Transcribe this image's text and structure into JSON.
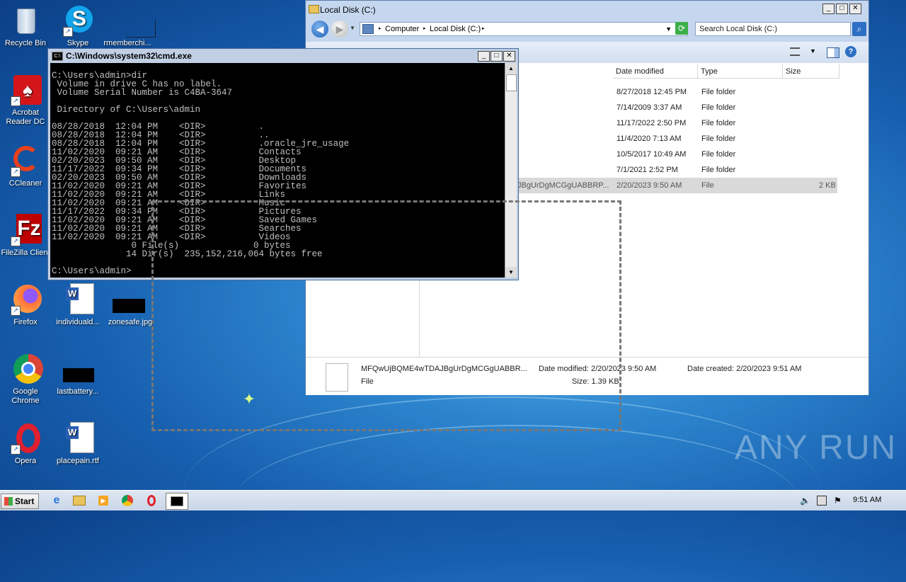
{
  "desktop_icons": [
    {
      "label": "Recycle Bin"
    },
    {
      "label": "Skype"
    },
    {
      "label": "rmemberchi..."
    },
    {
      "label": "Acrobat Reader DC"
    },
    {
      "label": "CCleaner"
    },
    {
      "label": "FileZilla Client"
    },
    {
      "label": "Firefox"
    },
    {
      "label": "individuald..."
    },
    {
      "label": "zonesafe.jpg"
    },
    {
      "label": "Google Chrome"
    },
    {
      "label": "lastbattery..."
    },
    {
      "label": "Opera"
    },
    {
      "label": "placepain.rtf"
    }
  ],
  "explorer": {
    "title": "Local Disk (C:)",
    "address": [
      "Computer",
      "Local Disk (C:)"
    ],
    "search_placeholder": "Search Local Disk (C:)",
    "columns": [
      "Date modified",
      "Type",
      "Size"
    ],
    "rows": [
      {
        "name": "",
        "date": "8/27/2018 12:45 PM",
        "type": "File folder",
        "size": ""
      },
      {
        "name": "",
        "date": "7/14/2009 3:37 AM",
        "type": "File folder",
        "size": ""
      },
      {
        "name": "",
        "date": "11/17/2022 2:50 PM",
        "type": "File folder",
        "size": ""
      },
      {
        "name": "",
        "date": "11/4/2020 7:13 AM",
        "type": "File folder",
        "size": ""
      },
      {
        "name": "",
        "date": "10/5/2017 10:49 AM",
        "type": "File folder",
        "size": ""
      },
      {
        "name": "",
        "date": "7/1/2021 2:52 PM",
        "type": "File folder",
        "size": ""
      },
      {
        "name": "JBgUrDgMCGgUABBRP...",
        "date": "2/20/2023 9:50 AM",
        "type": "File",
        "size": "2 KB",
        "selected": true
      }
    ],
    "details": {
      "filename": "MFQwUjBQME4wTDAJBgUrDgMCGgUABBR...",
      "filetype": "File",
      "date_modified": "Date modified: 2/20/2023 9:50 AM",
      "size": "Size: 1.39 KB",
      "date_created": "Date created: 2/20/2023 9:51 AM"
    }
  },
  "cmd": {
    "title": "C:\\Windows\\system32\\cmd.exe",
    "lines": [
      "C:\\Users\\admin>dir",
      " Volume in drive C has no label.",
      " Volume Serial Number is C4BA-3647",
      "",
      " Directory of C:\\Users\\admin",
      "",
      "08/28/2018  12:04 PM    <DIR>          .",
      "08/28/2018  12:04 PM    <DIR>          ..",
      "08/28/2018  12:04 PM    <DIR>          .oracle_jre_usage",
      "11/02/2020  09:21 AM    <DIR>          Contacts",
      "02/20/2023  09:50 AM    <DIR>          Desktop",
      "11/17/2022  09:34 PM    <DIR>          Documents",
      "02/20/2023  09:50 AM    <DIR>          Downloads",
      "11/02/2020  09:21 AM    <DIR>          Favorites",
      "11/02/2020  09:21 AM    <DIR>          Links",
      "11/02/2020  09:21 AM    <DIR>          Music",
      "11/17/2022  09:34 PM    <DIR>          Pictures",
      "11/02/2020  09:21 AM    <DIR>          Saved Games",
      "11/02/2020  09:21 AM    <DIR>          Searches",
      "11/02/2020  09:21 AM    <DIR>          Videos",
      "               0 File(s)              0 bytes",
      "              14 Dir(s)  235,152,216,064 bytes free",
      "",
      "C:\\Users\\admin>"
    ]
  },
  "watermark": "ANY RUN",
  "taskbar": {
    "start_label": "Start",
    "clock": "9:51 AM"
  }
}
